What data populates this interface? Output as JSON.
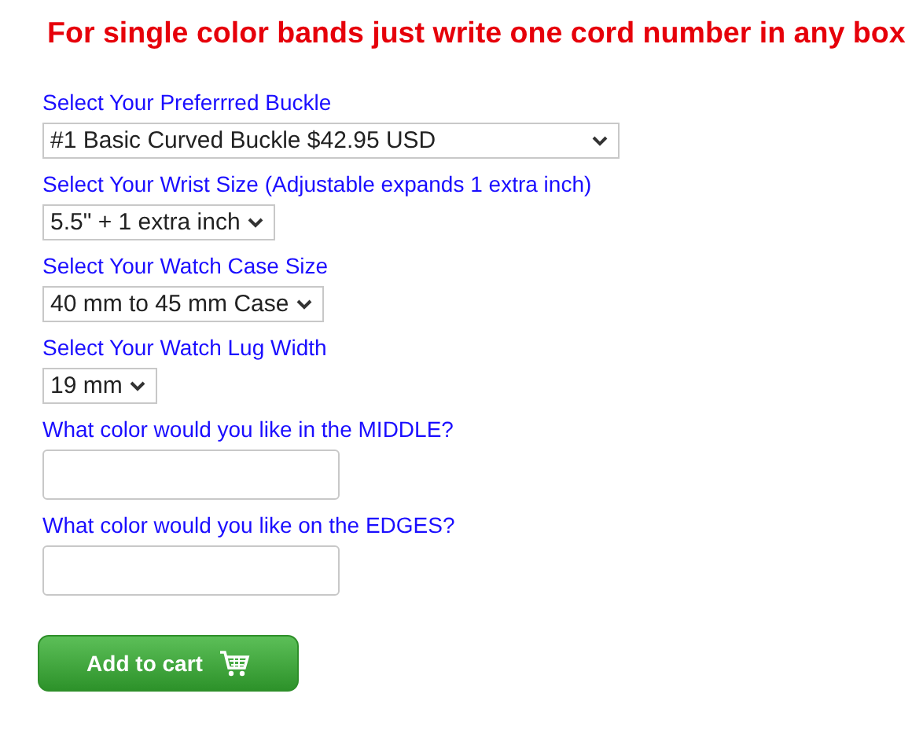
{
  "notice": "For single color bands just write one cord number in any box",
  "fields": [
    {
      "kind": "select",
      "label": "Select Your Preferrred Buckle",
      "value": "#1 Basic Curved Buckle $42.95 USD"
    },
    {
      "kind": "select",
      "label": "Select Your Wrist Size (Adjustable expands 1 extra inch)",
      "value": "5.5\" + 1 extra inch"
    },
    {
      "kind": "select",
      "label": "Select Your Watch Case Size",
      "value": "40 mm to 45 mm Case"
    },
    {
      "kind": "select",
      "label": "Select Your Watch Lug Width",
      "value": "19 mm"
    },
    {
      "kind": "text",
      "label": "What color would you like in the MIDDLE?"
    },
    {
      "kind": "text",
      "label": "What color would you like on the EDGES?"
    }
  ],
  "button": {
    "label": "Add to cart"
  }
}
